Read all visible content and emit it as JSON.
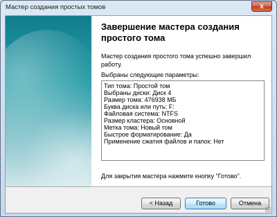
{
  "window": {
    "title": "Мастер создания простых томов",
    "close_label": "x"
  },
  "page": {
    "heading": "Завершение мастера создания простого тома",
    "status_text": "Мастер создания простого тома успешно завершил работу.",
    "params_label": "Выбраны следующие параметры:",
    "summary_lines": [
      "Тип тома: Простой том",
      "Выбраны диски: Диск 4",
      "Размер тома: 476938 МБ",
      "Буква диска или путь: F:",
      "Файловая система: NTFS",
      "Размер кластера: Основной",
      "Метка тома: Новый том",
      "Быстрое форматирование: Да",
      "Применение сжатия файлов и папок: Нет"
    ],
    "finish_hint": "Для закрытия мастера нажмите кнопку \"Готово\"."
  },
  "buttons": {
    "back": "< Назад",
    "finish": "Готово",
    "cancel": "Отмена"
  },
  "icons": {
    "close": "close-icon"
  }
}
